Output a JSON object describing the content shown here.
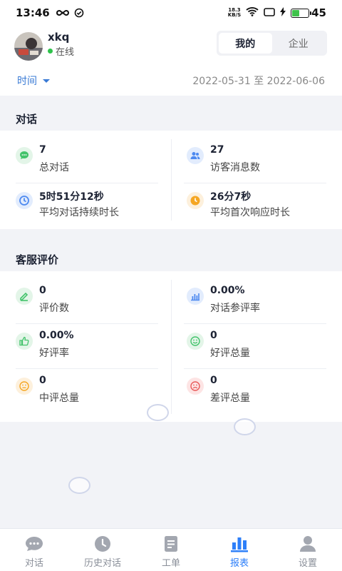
{
  "status_bar": {
    "time": "13:46",
    "net_speed_top": "18.3",
    "net_speed_bottom": "KB/S",
    "battery": "45",
    "battery_level": 0.45
  },
  "user": {
    "name": "xkq",
    "status": "在线"
  },
  "segment": {
    "mine": "我的",
    "enterprise": "企业",
    "selected": "我的"
  },
  "filter": {
    "label": "时间",
    "range": "2022-05-31 至 2022-06-06"
  },
  "conversation": {
    "title": "对话",
    "items": [
      {
        "value": "7",
        "label": "总对话",
        "icon": "chat-bubble-icon",
        "color": "#43c36b"
      },
      {
        "value": "27",
        "label": "访客消息数",
        "icon": "users-icon",
        "color": "#4e8af0"
      },
      {
        "value": "5时51分12秒",
        "label": "平均对话持续时长",
        "icon": "clock-icon",
        "color": "#4e8af0"
      },
      {
        "value": "26分7秒",
        "label": "平均首次响应时长",
        "icon": "clock-icon",
        "color": "#f5a623"
      }
    ]
  },
  "evaluation": {
    "title": "客服评价",
    "items": [
      {
        "value": "0",
        "label": "评价数",
        "icon": "pen-icon",
        "color": "#43c36b"
      },
      {
        "value": "0.00%",
        "label": "对话参评率",
        "icon": "bar-chart-icon",
        "color": "#4e8af0"
      },
      {
        "value": "0.00%",
        "label": "好评率",
        "icon": "thumbs-up-icon",
        "color": "#43c36b"
      },
      {
        "value": "0",
        "label": "好评总量",
        "icon": "smile-icon",
        "color": "#43c36b"
      },
      {
        "value": "0",
        "label": "中评总量",
        "icon": "neutral-face-icon",
        "color": "#f5a623"
      },
      {
        "value": "0",
        "label": "差评总量",
        "icon": "sad-face-icon",
        "color": "#e85a5a"
      }
    ]
  },
  "tabs": [
    {
      "label": "对话",
      "icon": "chat-icon",
      "active": false
    },
    {
      "label": "历史对话",
      "icon": "history-clock-icon",
      "active": false
    },
    {
      "label": "工单",
      "icon": "ticket-icon",
      "active": false
    },
    {
      "label": "报表",
      "icon": "report-chart-icon",
      "active": true
    },
    {
      "label": "设置",
      "icon": "person-settings-icon",
      "active": false
    }
  ]
}
